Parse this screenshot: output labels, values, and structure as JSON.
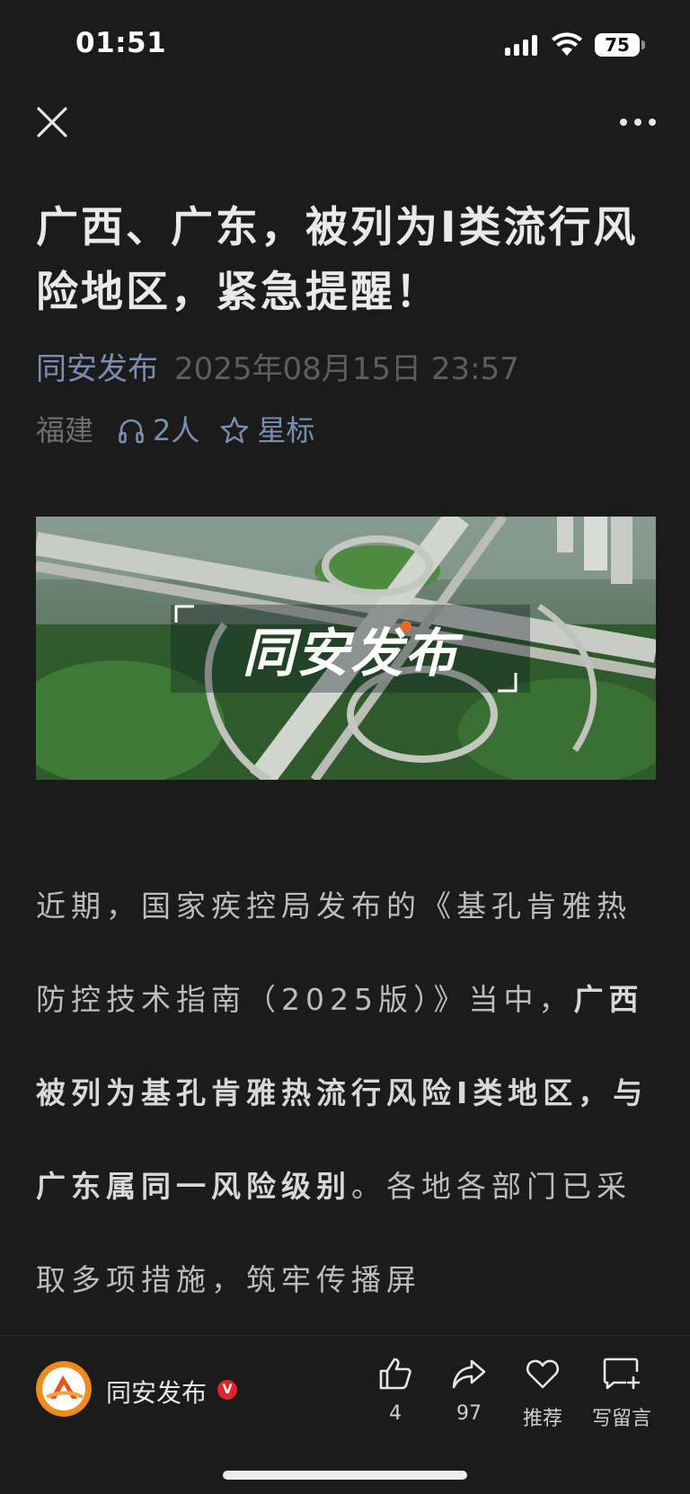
{
  "status_bar": {
    "time": "01:51",
    "battery": "75"
  },
  "nav": {
    "close_icon": "close-icon",
    "more_icon": "more-horizontal-icon"
  },
  "article": {
    "title": "广西、广东，被列为Ⅰ类流行风险地区，紧急提醒！",
    "author": "同安发布",
    "publish_time": "2025年08月15日 23:57",
    "location": "福建",
    "listeners": "2人",
    "star_label": "星标",
    "hero_banner_text": "同安发布",
    "paragraph_part1": "近期，国家疾控局发布的《基孔肯雅热防控技术指南（2025版）》当中，",
    "paragraph_bold": "广西被列为基孔肯雅热流行风险Ⅰ类地区，与广东属同一风险级别",
    "paragraph_part2": "。各地各部门已采取多项措施，筑牢传播屏"
  },
  "bottom_bar": {
    "account_name": "同安发布",
    "verified_mark": "V",
    "like_count": "4",
    "share_count": "97",
    "recommend_label": "推荐",
    "comment_label": "写留言"
  },
  "colors": {
    "background": "#1b1b1b",
    "link_blue": "#7a8eb0",
    "verified_red": "#e0242f"
  }
}
